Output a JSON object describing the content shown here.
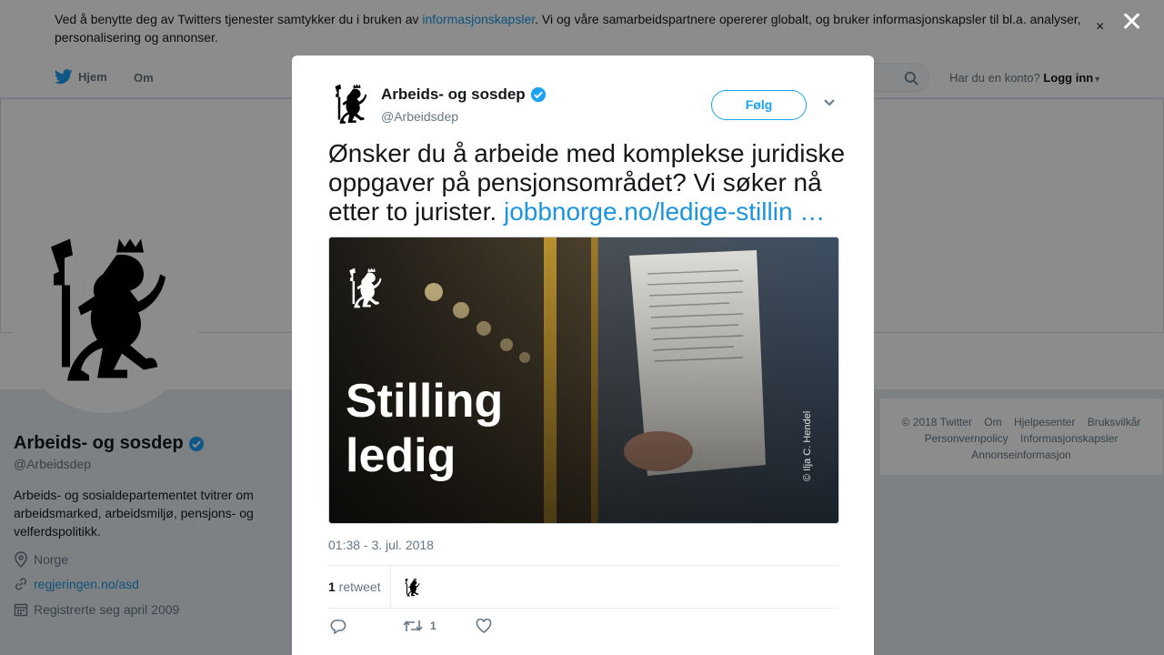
{
  "cookie": {
    "text_before": "Ved å benytte deg av Twitters tjenester samtykker du i bruken av ",
    "link": "informasjonskapsler",
    "text_after": ". Vi og våre samarbeidspartnere opererer globalt, og bruker informasjonskapsler til bl.a. analyser, personalisering og annonser.",
    "close": "×"
  },
  "overlay_close": "✕",
  "nav": {
    "home": "Hjem",
    "about": "Om",
    "account_question": "Har du en konto?",
    "login": "Logg inn"
  },
  "profile": {
    "name": "Arbeids- og sosdep",
    "handle": "@Arbeidsdep",
    "bio": "Arbeids- og sosialdepartementet tvitrer om arbeidsmarked, arbeidsmiljø, pensjons- og velferdspolitikk.",
    "location": "Norge",
    "website": "regjeringen.no/asd",
    "joined": "Registrerte seg april 2009"
  },
  "footer": {
    "line1": [
      "© 2018 Twitter",
      "Om",
      "Hjelpesenter",
      "Bruksvilkår"
    ],
    "line2": [
      "Personvernpolicy",
      "Informasjonskapsler"
    ],
    "line3": [
      "Annonseinformasjon"
    ]
  },
  "tweet": {
    "name": "Arbeids- og sosdep",
    "handle": "@Arbeidsdep",
    "follow": "Følg",
    "text": "Ønsker du å arbeide med komplekse juridiske oppgaver på pensjonsområdet? Vi søker nå etter to jurister. ",
    "link": "jobbnorge.no/ledige-stillin …",
    "media": {
      "line1": "Stilling",
      "line2": "ledig",
      "credit": "© Ilja C. Hendel"
    },
    "timestamp": "01:38 - 3. jul. 2018",
    "retweet_count": "1",
    "retweet_label": " retweet",
    "action_retweet_count": "1"
  },
  "colors": {
    "brand": "#1da1f2",
    "link": "#1b95e0",
    "verified": "#1da1f2"
  }
}
